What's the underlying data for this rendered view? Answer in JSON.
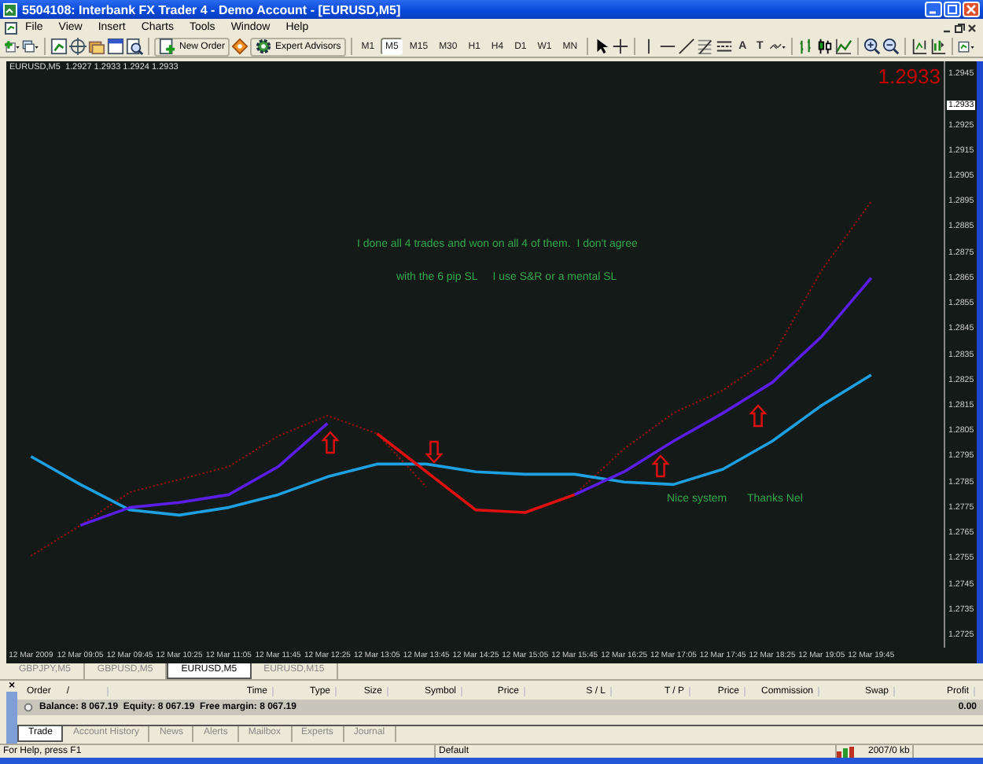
{
  "window": {
    "title": "5504108: Interbank FX Trader 4 - Demo Account - [EURUSD,M5]"
  },
  "menu": [
    "File",
    "View",
    "Insert",
    "Charts",
    "Tools",
    "Window",
    "Help"
  ],
  "toolbar": {
    "buttons": [
      {
        "label": "New Order"
      },
      {
        "label": "Expert Advisors"
      }
    ],
    "timeframes": [
      {
        "label": "M1",
        "selected": false
      },
      {
        "label": "M5",
        "selected": true
      },
      {
        "label": "M15",
        "selected": false
      },
      {
        "label": "M30",
        "selected": false
      },
      {
        "label": "H1",
        "selected": false
      },
      {
        "label": "H4",
        "selected": false
      },
      {
        "label": "D1",
        "selected": false
      },
      {
        "label": "W1",
        "selected": false
      },
      {
        "label": "MN",
        "selected": false
      }
    ],
    "text_tools": [
      "A",
      "T"
    ]
  },
  "chart": {
    "header": "EURUSD,M5  1.2927 1.2933 1.2924 1.2933",
    "current_price": "1.2933",
    "axis_price": "1.2933",
    "chart_data": {
      "type": "line",
      "categories": [
        "12 Mar 2009",
        "12 Mar 09:05",
        "12 Mar 09:45",
        "12 Mar 10:25",
        "12 Mar 11:05",
        "12 Mar 11:45",
        "12 Mar 12:25",
        "12 Mar 13:05",
        "12 Mar 13:45",
        "12 Mar 14:25",
        "12 Mar 15:05",
        "12 Mar 15:45",
        "12 Mar 16:25",
        "12 Mar 17:05",
        "12 Mar 17:45",
        "12 Mar 18:25",
        "12 Mar 19:05",
        "12 Mar 19:45",
        null
      ],
      "ylim": [
        1.272,
        1.295
      ],
      "yticks": [
        {
          "value": 1.2945,
          "label": "1.2945"
        },
        {
          "value": 1.2925,
          "label": "1.2925"
        },
        {
          "value": 1.2915,
          "label": "1.2915"
        },
        {
          "value": 1.2905,
          "label": "1.2905"
        },
        {
          "value": 1.2895,
          "label": "1.2895"
        },
        {
          "value": 1.2885,
          "label": "1.2885"
        },
        {
          "value": 1.2875,
          "label": "1.2875"
        },
        {
          "value": 1.2865,
          "label": "1.2865"
        },
        {
          "value": 1.2855,
          "label": "1.2855"
        },
        {
          "value": 1.2845,
          "label": "1.2845"
        },
        {
          "value": 1.2835,
          "label": "1.2835"
        },
        {
          "value": 1.2825,
          "label": "1.2825"
        },
        {
          "value": 1.2815,
          "label": "1.2815"
        },
        {
          "value": 1.2805,
          "label": "1.2805"
        },
        {
          "value": 1.2795,
          "label": "1.2795"
        },
        {
          "value": 1.2785,
          "label": "1.2785"
        },
        {
          "value": 1.2775,
          "label": "1.2775"
        },
        {
          "value": 1.2765,
          "label": "1.2765"
        },
        {
          "value": 1.2755,
          "label": "1.2755"
        },
        {
          "value": 1.2745,
          "label": "1.2745"
        },
        {
          "value": 1.2735,
          "label": "1.2735"
        },
        {
          "value": 1.2725,
          "label": "1.2725"
        }
      ],
      "series": [
        {
          "color": "#a01010",
          "line_style": "dotted",
          "values": [
            1.2756,
            1.2768,
            1.2781,
            1.2786,
            1.2791,
            1.2803,
            1.2811,
            1.2804,
            1.2783,
            null,
            null,
            null,
            null,
            null,
            null,
            null,
            null,
            null,
            null
          ]
        },
        {
          "color": "#a01010",
          "line_style": "dotted",
          "values": [
            null,
            null,
            null,
            null,
            null,
            null,
            null,
            null,
            null,
            null,
            null,
            1.278,
            1.2798,
            1.2812,
            1.2821,
            1.2834,
            1.2868,
            1.2895,
            null
          ]
        },
        {
          "color": "#1ea0e0",
          "values": [
            1.2795,
            1.2784,
            1.2774,
            1.2772,
            1.2775,
            1.278,
            1.2787,
            1.2792,
            1.2792,
            1.2789,
            1.2788,
            1.2788,
            1.2785,
            1.2784,
            1.279,
            1.2801,
            1.2815,
            1.2827,
            null
          ]
        },
        {
          "color": "#5a1ee6",
          "values": [
            null,
            1.2768,
            1.2775,
            1.2777,
            1.278,
            1.2791,
            1.2808,
            null,
            null,
            null,
            null,
            null,
            null,
            null,
            null,
            null,
            null,
            null,
            null
          ]
        },
        {
          "color": "#5a1ee6",
          "values": [
            null,
            null,
            null,
            null,
            null,
            null,
            null,
            null,
            null,
            null,
            null,
            1.278,
            1.2789,
            1.2801,
            1.2812,
            1.2824,
            1.2842,
            1.2865,
            null
          ]
        },
        {
          "color": "#e01010",
          "values": [
            null,
            null,
            null,
            null,
            null,
            null,
            null,
            1.2804,
            1.2789,
            1.2774,
            1.2773,
            1.278,
            null,
            null,
            null,
            null,
            null,
            null,
            null
          ]
        }
      ]
    },
    "notes": [
      "I done all 4 trades and won on all 4 of them.  I don't agree",
      "with the 6 pip SL     I use S&R or a mental SL",
      "Nice system",
      "Thanks Nel"
    ]
  },
  "chart_tabs": [
    {
      "label": "GBPJPY,M5",
      "selected": false
    },
    {
      "label": "GBPUSD,M5",
      "selected": false
    },
    {
      "label": "EURUSD,M5",
      "selected": true
    },
    {
      "label": "EURUSD,M15",
      "selected": false
    }
  ],
  "terminal": {
    "close": "×",
    "sort_mark": "/",
    "columns": [
      "Order",
      "Time",
      "Type",
      "Size",
      "Symbol",
      "Price",
      "S / L",
      "T / P",
      "Price",
      "Commission",
      "Swap",
      "Profit"
    ],
    "balance": "Balance: 8 067.19  Equity: 8 067.19  Free margin: 8 067.19",
    "profit": "0.00",
    "tabs": [
      {
        "label": "Trade",
        "selected": true
      },
      {
        "label": "Account History",
        "selected": false
      },
      {
        "label": "News",
        "selected": false
      },
      {
        "label": "Alerts",
        "selected": false
      },
      {
        "label": "Mailbox",
        "selected": false
      },
      {
        "label": "Experts",
        "selected": false
      },
      {
        "label": "Journal",
        "selected": false
      }
    ]
  },
  "status_bar": [
    "For Help, press F1",
    "Default",
    "2007/0 kb"
  ]
}
